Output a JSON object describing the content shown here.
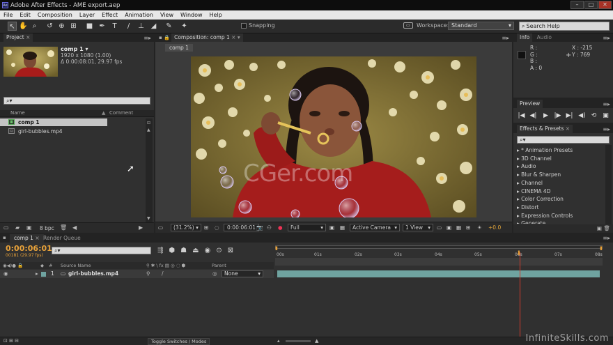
{
  "window": {
    "title": "Adobe After Effects - AME export.aep",
    "logo": "Ae",
    "controls": [
      "–",
      "□",
      "✕"
    ]
  },
  "menu": [
    "File",
    "Edit",
    "Composition",
    "Layer",
    "Effect",
    "Animation",
    "View",
    "Window",
    "Help"
  ],
  "toolbar": {
    "snapping_label": "Snapping",
    "workspace_label": "Workspace:",
    "workspace_value": "Standard",
    "search_placeholder": "Search Help"
  },
  "project": {
    "tab": "Project",
    "comp_name": "comp 1 ▾",
    "comp_size": "1920 x 1080 (1.00)",
    "comp_duration": "Δ 0:00:08:01, 29.97 fps",
    "search_icon": "⌕▾",
    "col_name": "Name",
    "col_comment": "Comment",
    "items": [
      "comp 1",
      "girl-bubbles.mp4"
    ],
    "bpc": "8 bpc"
  },
  "composition": {
    "tab": "Composition: comp 1",
    "sub_tab": "comp 1",
    "watermark": "CGer.com",
    "zoom": "(31.2%)",
    "timecode": "0:00:06:01",
    "resolution": "Full",
    "camera": "Active Camera",
    "views": "1 View",
    "exposure": "+0.0"
  },
  "info": {
    "tab_info": "Info",
    "tab_audio": "Audio",
    "r": "R :",
    "g": "G :",
    "b": "B :",
    "a": "A : 0",
    "x": "X : -215",
    "y": "Y : 769",
    "plus": "+"
  },
  "preview": {
    "tab": "Preview",
    "buttons": [
      "|◀",
      "◀|",
      "▶",
      "|▶",
      "▶|",
      "◀)",
      "⟲",
      "▣"
    ]
  },
  "effects": {
    "tab": "Effects & Presets",
    "search_icon": "⌕▾",
    "items": [
      "▸ * Animation Presets",
      "▸ 3D Channel",
      "▸ Audio",
      "▸ Blur & Sharpen",
      "▸ Channel",
      "▸ CINEMA 4D",
      "▸ Color Correction",
      "▸ Distort",
      "▸ Expression Controls",
      "▸ Generate"
    ]
  },
  "timeline": {
    "tab": "comp 1",
    "tab2": "Render Queue",
    "timecode": "0:00:06:01",
    "frame_info": "00181 (29.97 fps)",
    "search_icon": "⌕▾",
    "col_source": "Source Name",
    "col_parent": "Parent",
    "layer_number": "1",
    "layer_name": "girl-bubbles.mp4",
    "parent_value": "None",
    "ruler": [
      "00s",
      "01s",
      "02s",
      "03s",
      "04s",
      "05s",
      "06s",
      "07s",
      "08s"
    ],
    "toggle_label": "Toggle Switches / Modes",
    "watermark": "InfiniteSkills.com"
  },
  "colors": {
    "accent_orange": "#e8a23a",
    "playhead_red": "#d23c2c",
    "layer_bar": "#6fa3a0"
  }
}
